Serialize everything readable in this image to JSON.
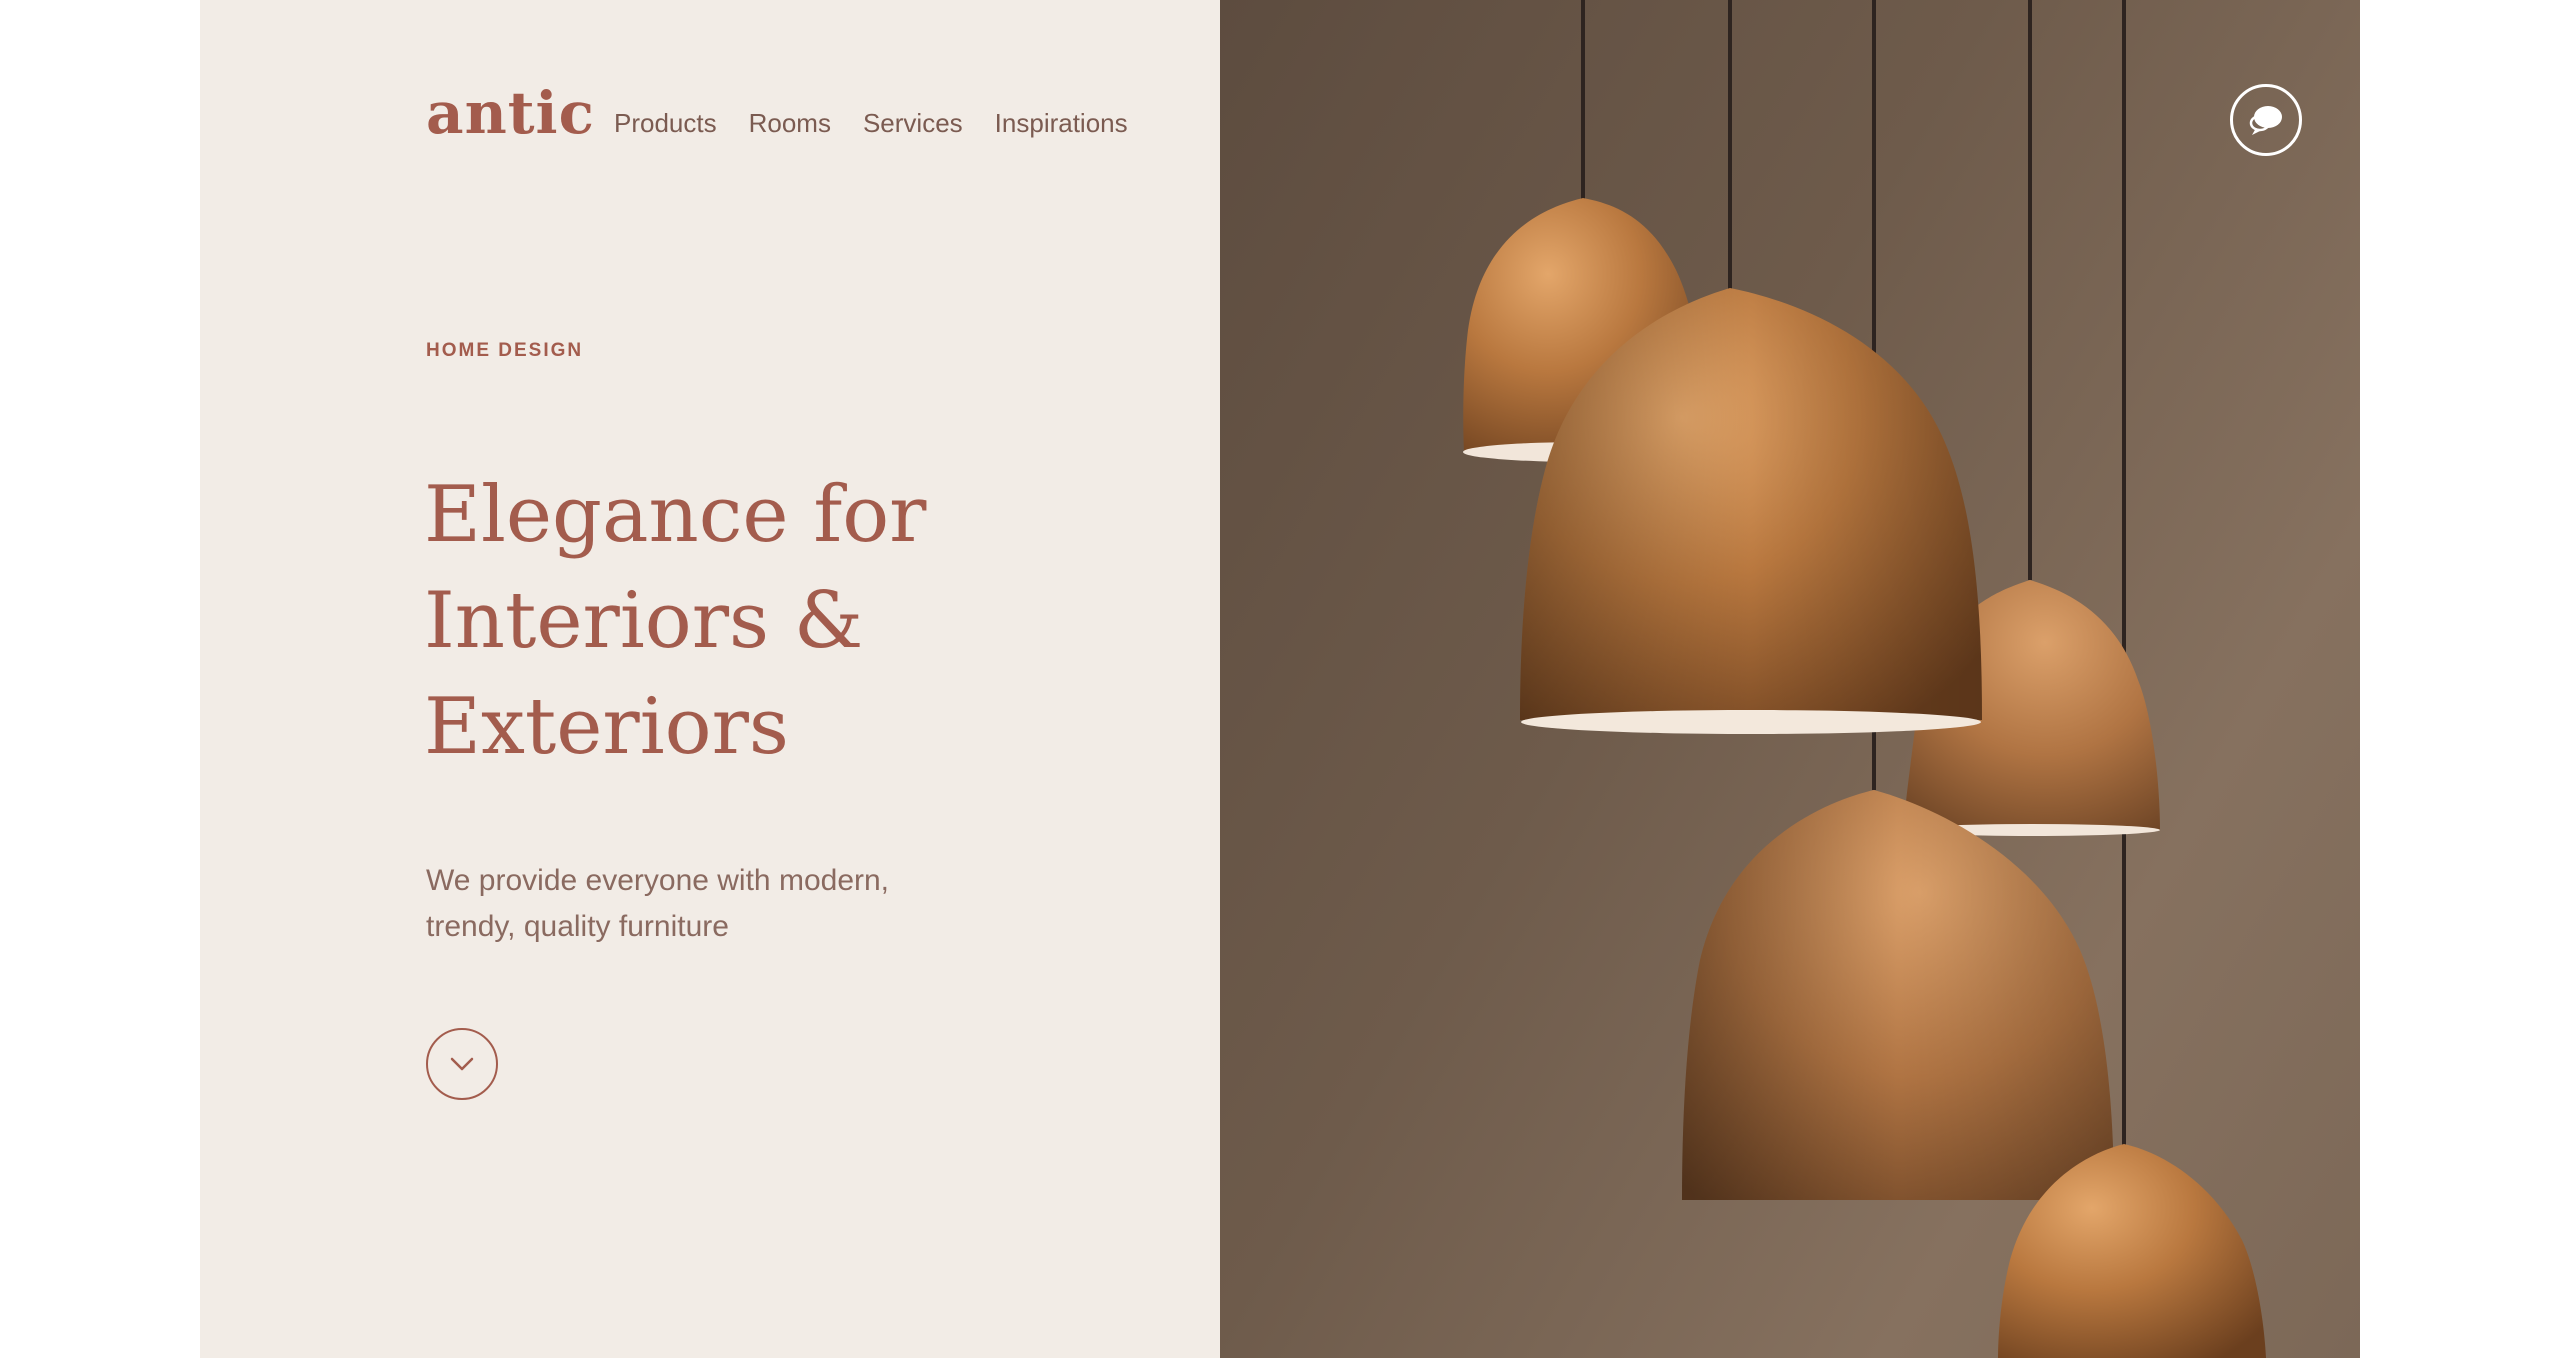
{
  "brand": {
    "logo": "antic"
  },
  "nav": {
    "items": [
      {
        "label": "Products"
      },
      {
        "label": "Rooms"
      },
      {
        "label": "Services"
      },
      {
        "label": "Inspirations"
      }
    ]
  },
  "hero": {
    "eyebrow": "HOME DESIGN",
    "headline_lines": [
      "Elegance for",
      "Interiors &",
      "Exteriors"
    ],
    "subtitle_lines": [
      "We provide everyone with modern,",
      "trendy, quality furniture"
    ],
    "scroll_icon": "chevron-down-icon"
  },
  "image_panel": {
    "subject": "copper pendant lamps",
    "chat_icon": "chat-bubbles-icon"
  },
  "colors": {
    "accent": "#a35c4d",
    "left_background": "#f2ece6",
    "nav_text": "#7b5b51",
    "body_text": "#8a6a60",
    "copper": "#b9783f"
  }
}
